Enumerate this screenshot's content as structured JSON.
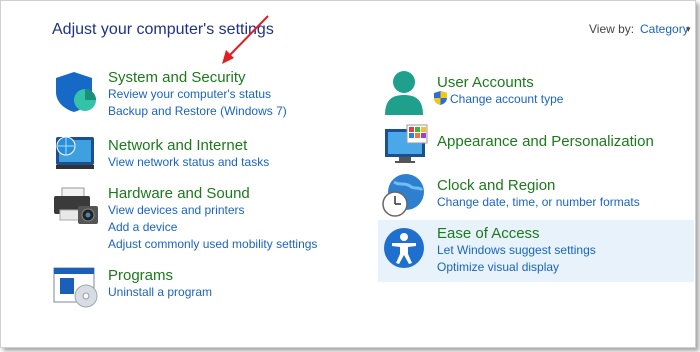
{
  "header": {
    "title": "Adjust your computer's settings",
    "view_by_label": "View by:",
    "view_by_value": "Category"
  },
  "left": {
    "system": {
      "title": "System and Security",
      "links": [
        "Review your computer's status",
        "Backup and Restore (Windows 7)"
      ]
    },
    "network": {
      "title": "Network and Internet",
      "links": [
        "View network status and tasks"
      ]
    },
    "hardware": {
      "title": "Hardware and Sound",
      "links": [
        "View devices and printers",
        "Add a device",
        "Adjust commonly used mobility settings"
      ]
    },
    "programs": {
      "title": "Programs",
      "links": [
        "Uninstall a program"
      ]
    }
  },
  "right": {
    "users": {
      "title": "User Accounts",
      "links": [
        "Change account type"
      ]
    },
    "appearance": {
      "title": "Appearance and Personalization",
      "links": []
    },
    "clock": {
      "title": "Clock and Region",
      "links": [
        "Change date, time, or number formats"
      ]
    },
    "ease": {
      "title": "Ease of Access",
      "links": [
        "Let Windows suggest settings",
        "Optimize visual display"
      ]
    }
  },
  "colors": {
    "title_blue": "#1e3287",
    "category_green": "#1c7a1c",
    "link_blue": "#1a64c0",
    "highlight": "#e8f2fb",
    "annotation_arrow": "#e02020"
  }
}
